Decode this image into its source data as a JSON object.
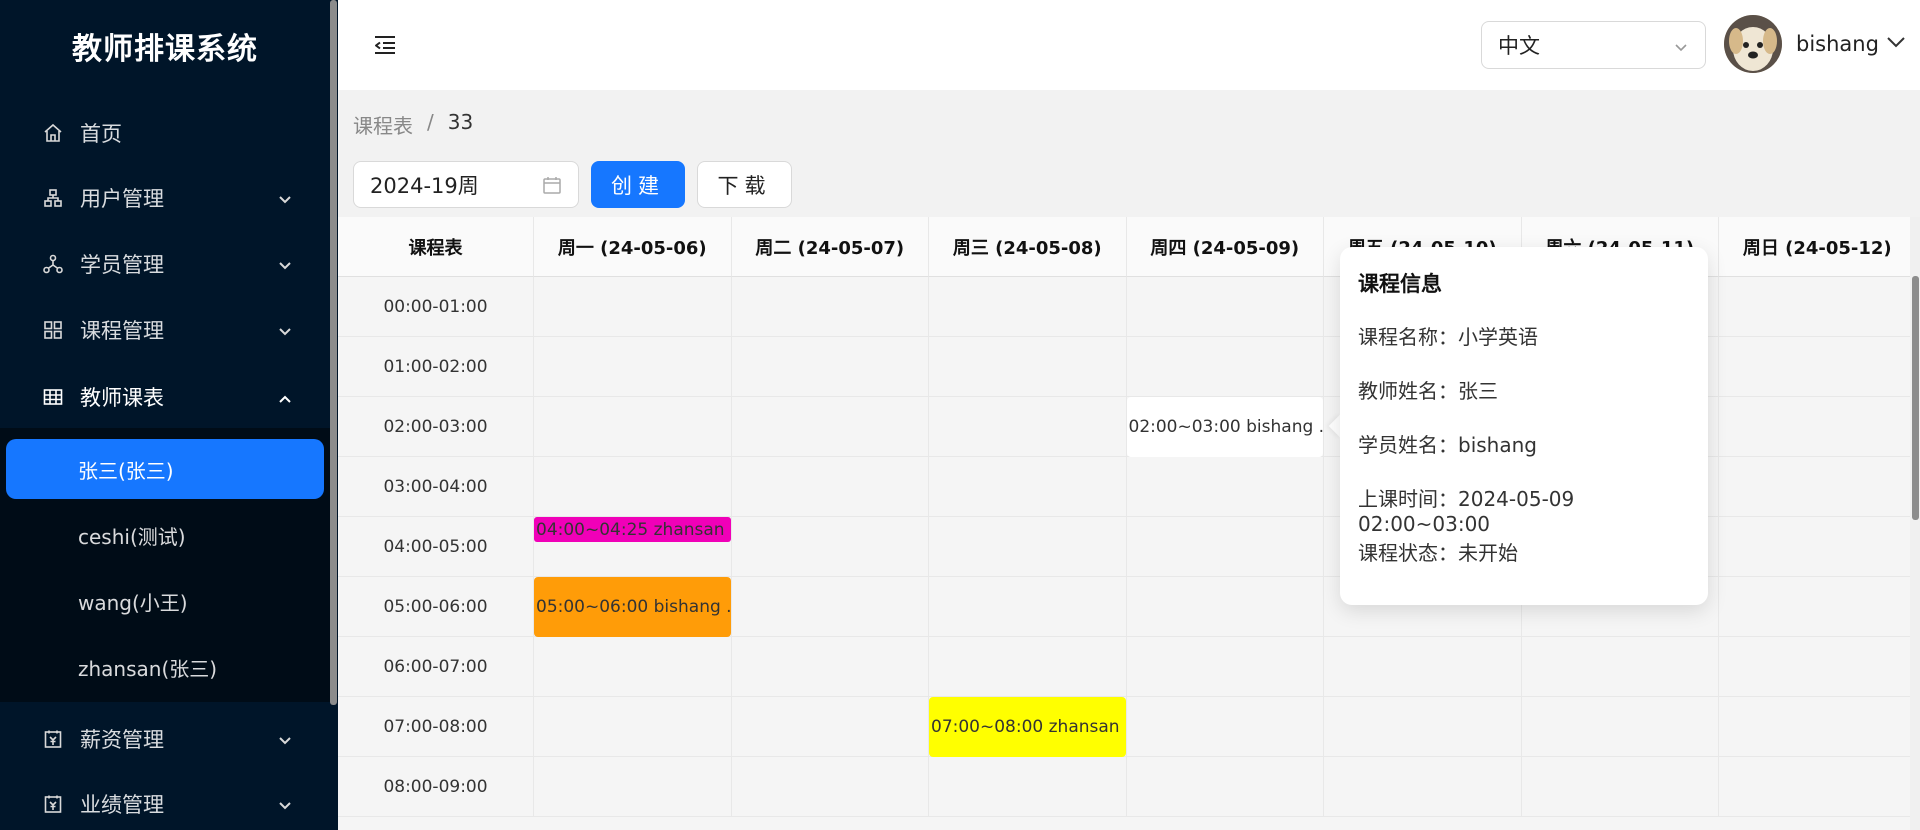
{
  "app": {
    "title": "教师排课系统"
  },
  "sidebar": {
    "items": [
      {
        "label": "首页",
        "icon": "home-icon"
      },
      {
        "label": "用户管理",
        "icon": "user-org-icon",
        "arrow": "down"
      },
      {
        "label": "学员管理",
        "icon": "student-network-icon",
        "arrow": "down"
      },
      {
        "label": "课程管理",
        "icon": "grid-apps-icon",
        "arrow": "down"
      },
      {
        "label": "教师课表",
        "icon": "table-icon",
        "arrow": "up"
      },
      {
        "label": "薪资管理",
        "icon": "salary-icon",
        "arrow": "down"
      },
      {
        "label": "业绩管理",
        "icon": "performance-icon",
        "arrow": "down"
      }
    ],
    "submenu": [
      {
        "label": "张三(张三)",
        "active": true
      },
      {
        "label": "ceshi(测试)"
      },
      {
        "label": "wang(小王)"
      },
      {
        "label": "zhansan(张三)"
      }
    ]
  },
  "header": {
    "language": "中文",
    "username": "bishang"
  },
  "breadcrumb": {
    "parent": "课程表",
    "separator": "/",
    "current": "33"
  },
  "toolbar": {
    "week_value": "2024-19周",
    "create_label": "创建",
    "download_label": "下载"
  },
  "schedule": {
    "corner": "课程表",
    "days": [
      "周一 (24-05-06)",
      "周二 (24-05-07)",
      "周三 (24-05-08)",
      "周四 (24-05-09)",
      "周五 (24-05-10)",
      "周六 (24-05-11)",
      "周日 (24-05-12)"
    ],
    "times": [
      "00:00-01:00",
      "01:00-02:00",
      "02:00-03:00",
      "03:00-04:00",
      "04:00-05:00",
      "05:00-06:00",
      "06:00-07:00",
      "07:00-08:00",
      "08:00-09:00"
    ],
    "events": [
      {
        "day": 3,
        "hour": 2,
        "start_min": 0,
        "end_min": 60,
        "label": "02:00~03:00 bishang ...",
        "color": "#ffffff"
      },
      {
        "day": 0,
        "hour": 4,
        "start_min": 0,
        "end_min": 25,
        "label": "04:00~04:25 zhansan ...",
        "color": "#f000b8"
      },
      {
        "day": 0,
        "hour": 5,
        "start_min": 0,
        "end_min": 60,
        "label": "05:00~06:00 bishang ...",
        "color": "#ff9c08"
      },
      {
        "day": 2,
        "hour": 7,
        "start_min": 0,
        "end_min": 60,
        "label": "07:00~08:00 zhansan ...",
        "color": "#ffff00"
      }
    ]
  },
  "popover": {
    "title": "课程信息",
    "rows": [
      "课程名称：小学英语",
      "教师姓名：张三",
      "学员姓名：bishang",
      "上课时间：2024-05-09 02:00~03:00",
      "课程状态：未开始"
    ]
  },
  "colors": {
    "sidebar_bg": "#001529",
    "submenu_bg": "#000c17",
    "primary": "#1677ff"
  }
}
